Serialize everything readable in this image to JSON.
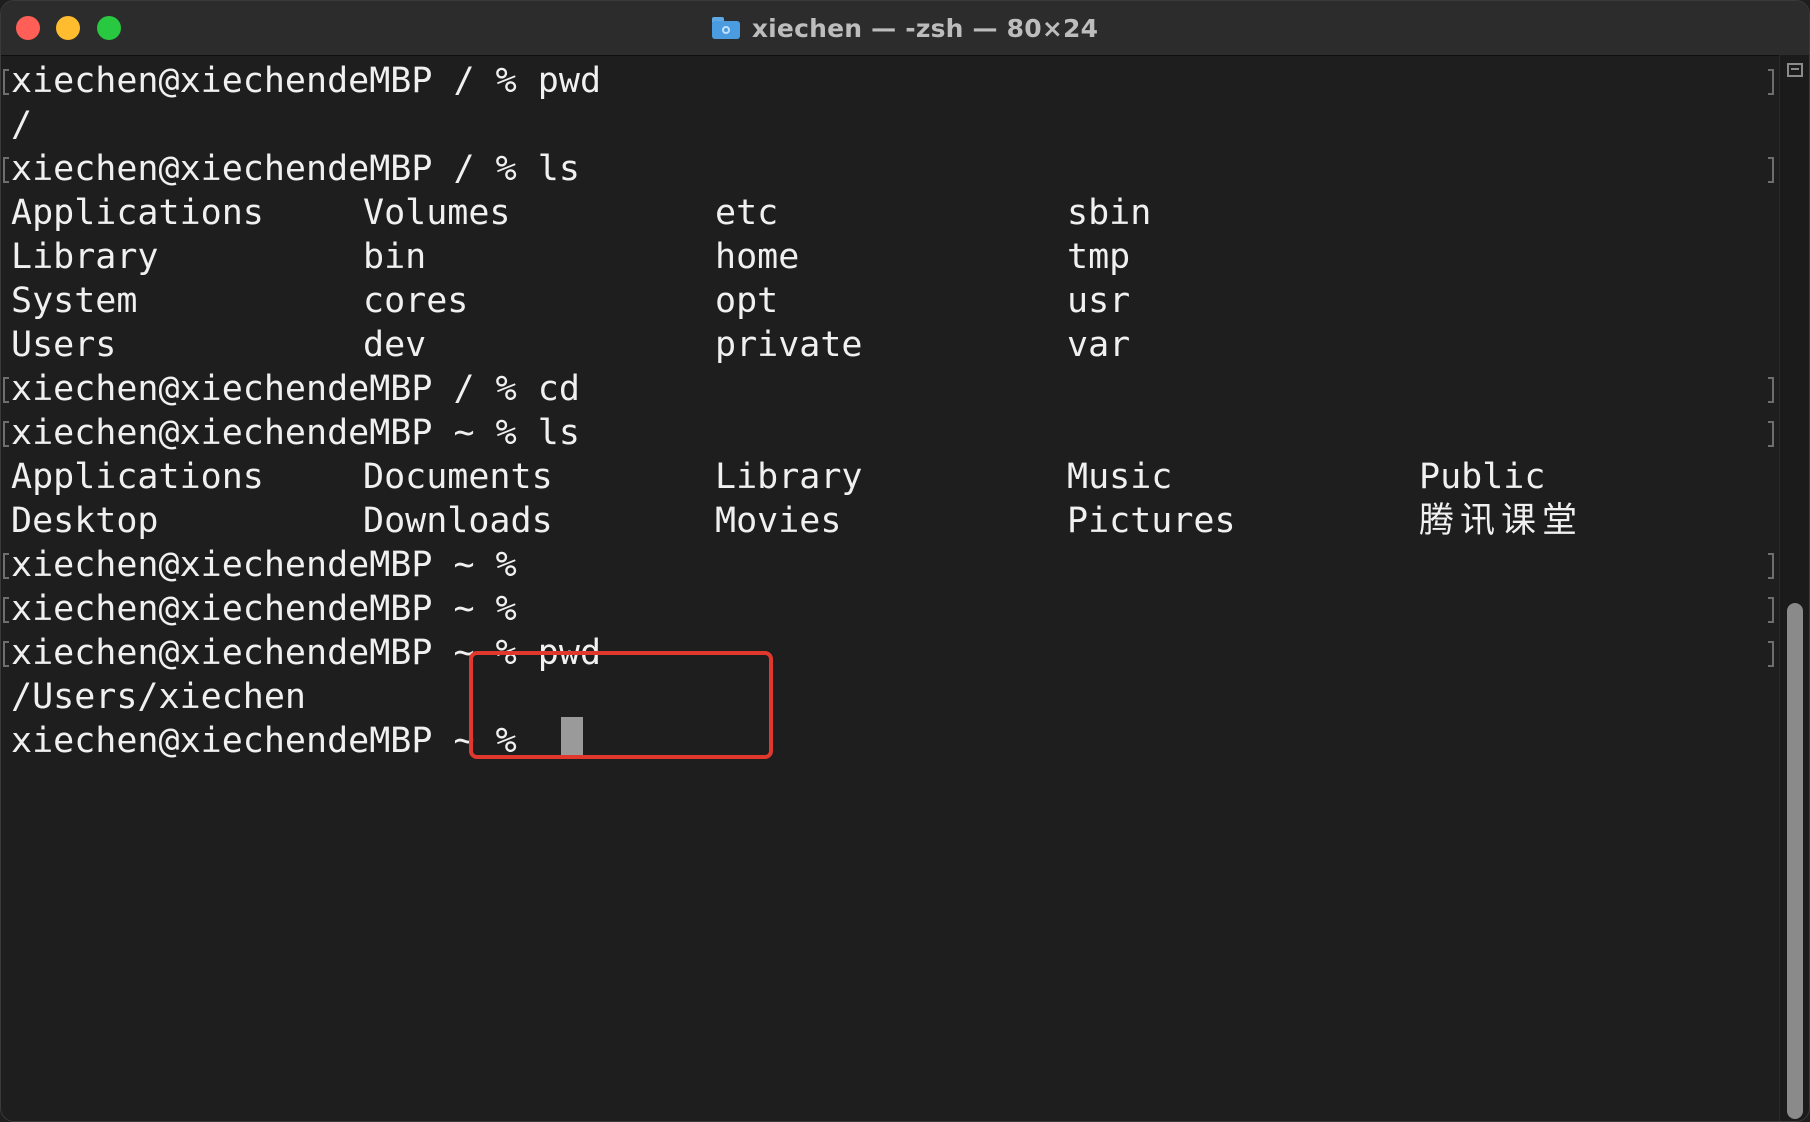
{
  "window": {
    "title": "xiechen — -zsh — 80×24"
  },
  "terminal": {
    "lines": [
      "xiechen@xiechendeMBP / % pwd",
      "/",
      "xiechen@xiechendeMBP / % ls",
      "xiechen@xiechendeMBP / % cd",
      "xiechen@xiechendeMBP ~ % ls",
      "xiechen@xiechendeMBP ~ %",
      "xiechen@xiechendeMBP ~ %",
      "xiechen@xiechendeMBP ~ % pwd",
      "/Users/xiechen",
      "xiechen@xiechendeMBP ~ % "
    ],
    "root_listing": [
      [
        "Applications",
        "Volumes",
        "etc",
        "sbin"
      ],
      [
        "Library",
        "bin",
        "home",
        "tmp"
      ],
      [
        "System",
        "cores",
        "opt",
        "usr"
      ],
      [
        "Users",
        "dev",
        "private",
        "var"
      ]
    ],
    "home_listing": [
      [
        "Applications",
        "Documents",
        "Library",
        "Music",
        "Public"
      ],
      [
        "Desktop",
        "Downloads",
        "Movies",
        "Pictures",
        "腾讯课堂"
      ]
    ]
  },
  "colors": {
    "background": "#1e1e1e",
    "text": "#f0f0f0",
    "highlight": "#e0382c",
    "cursor": "#9a9a9a"
  },
  "icons": {
    "title_icon": "folder-icon",
    "scroll_marks": "marks-icon"
  }
}
